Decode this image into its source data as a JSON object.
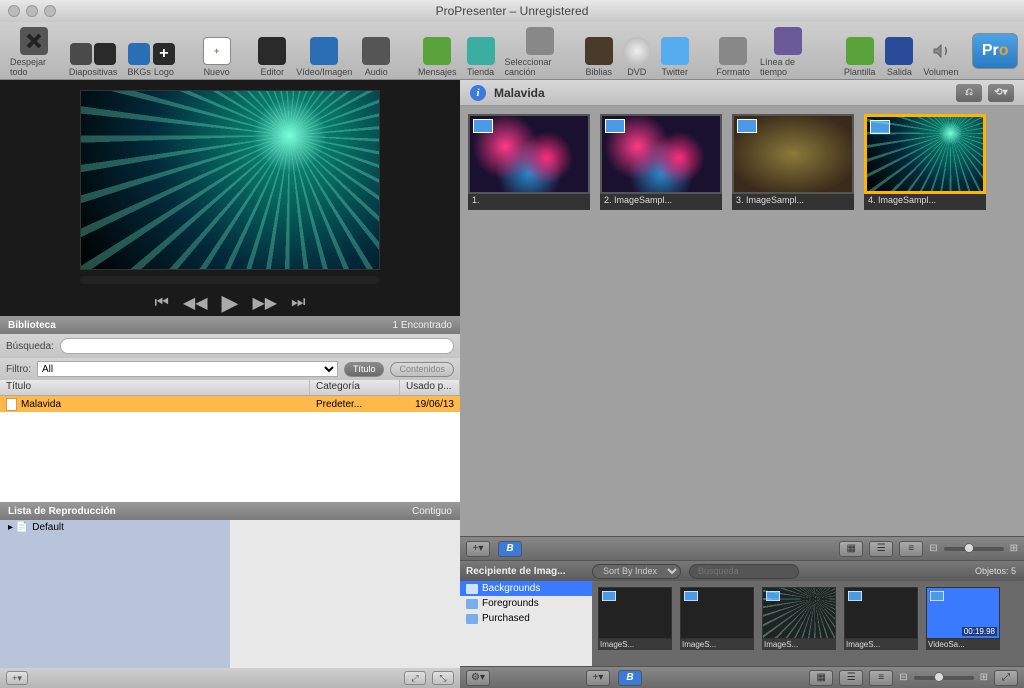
{
  "titlebar": {
    "title": "ProPresenter – Unregistered"
  },
  "toolbar": {
    "clear_all": "Despejar todo",
    "slides": "Diapositivas",
    "bkgs": "BKGs",
    "logo": "Logo",
    "new": "Nuevo",
    "editor": "Editor",
    "video_image": "Vídeo/Imagen",
    "audio": "Audio",
    "messages": "Mensajes",
    "store": "Tienda",
    "select_song": "Seleccionar canción",
    "bibles": "Biblias",
    "dvd": "DVD",
    "twitter": "Twitter",
    "format": "Formato",
    "timeline": "Línea de tiempo",
    "template": "Plantilla",
    "output": "Salida",
    "volume": "Volumen",
    "pro": "Pro"
  },
  "library": {
    "title": "Biblioteca",
    "found": "1 Encontrado",
    "search_label": "Búsqueda:",
    "filter_label": "Filtro:",
    "filter_value": "All",
    "btn_title": "Título",
    "btn_contents": "Contenidos",
    "cols": {
      "title": "Título",
      "category": "Categoría",
      "used": "Usado p..."
    },
    "rows": [
      {
        "title": "Malavida",
        "category": "Predeter...",
        "used": "19/06/13"
      }
    ]
  },
  "playlist": {
    "title": "Lista de Reproducción",
    "contiguous": "Contiguo",
    "items": [
      "Default"
    ]
  },
  "doc": {
    "title": "Malavida",
    "slides": [
      {
        "label": "1."
      },
      {
        "label": "2. ImageSampl..."
      },
      {
        "label": "3. ImageSampl..."
      },
      {
        "label": "4. ImageSampl..."
      }
    ]
  },
  "bin": {
    "title": "Recipiente de Imag...",
    "sort_label": "Sort By Index",
    "search_placeholder": "Búsqueda",
    "objects": "Objetos: 5",
    "cats": [
      "Backgrounds",
      "Foregrounds",
      "Purchased"
    ],
    "thumbs": [
      {
        "label": "ImageS..."
      },
      {
        "label": "ImageS..."
      },
      {
        "label": "ImageS..."
      },
      {
        "label": "ImageS..."
      },
      {
        "label": "VideoSa...",
        "duration": "00:19.98"
      }
    ]
  }
}
